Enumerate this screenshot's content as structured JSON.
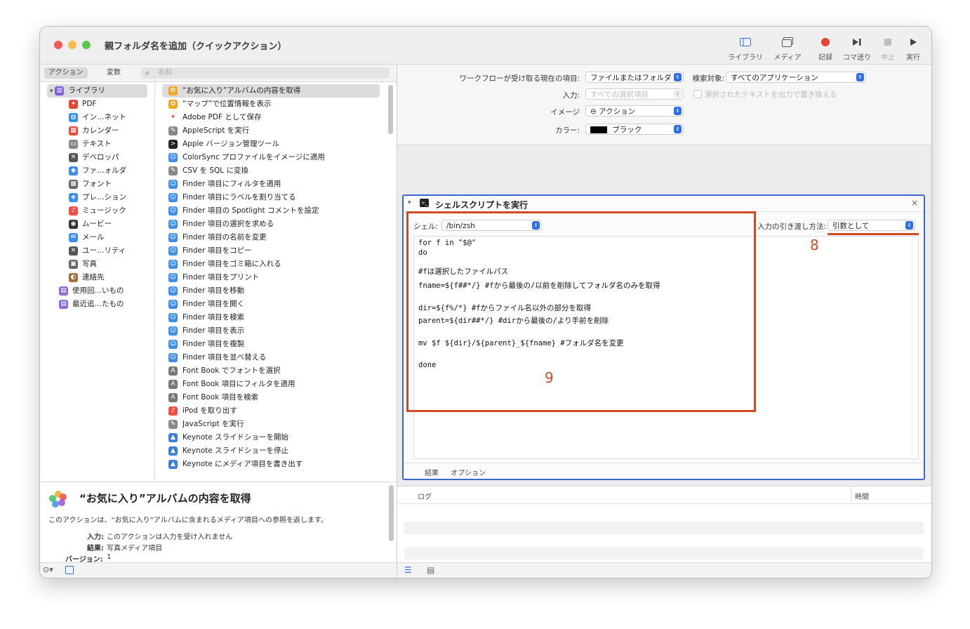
{
  "window": {
    "title": "親フォルダ名を追加（クイックアクション）"
  },
  "toolbar": {
    "library": "ライブラリ",
    "media": "メディア",
    "record": "記録",
    "step": "コマ送り",
    "stop": "中止",
    "run": "実行"
  },
  "left_header": {
    "actions_tab": "アクション",
    "variables_tab": "変数",
    "search_placeholder": "名前"
  },
  "categories": [
    "ライブラリ",
    "PDF",
    "イン…ネット",
    "カレンダー",
    "テキスト",
    "デベロッパ",
    "ファ…ォルダ",
    "フォント",
    "プレ…ション",
    "ミュージック",
    "ムービー",
    "メール",
    "ユー…リティ",
    "写真",
    "連絡先",
    "使用回…いもの",
    "最近追…たもの"
  ],
  "actions": [
    "“お気に入り”アルバムの内容を取得",
    "“マップ”で位置情報を表示",
    "Adobe PDF として保存",
    "AppleScript を実行",
    "Apple バージョン管理ツール",
    "ColorSync プロファイルをイメージに適用",
    "CSV を SQL に変換",
    "Finder 項目にフィルタを適用",
    "Finder 項目にラベルを割り当てる",
    "Finder 項目の Spotlight コメントを設定",
    "Finder 項目の選択を求める",
    "Finder 項目の名前を変更",
    "Finder 項目をコピー",
    "Finder 項目をゴミ箱に入れる",
    "Finder 項目をプリント",
    "Finder 項目を移動",
    "Finder 項目を開く",
    "Finder 項目を検索",
    "Finder 項目を表示",
    "Finder 項目を複製",
    "Finder 項目を並べ替える",
    "Font Book でフォントを選択",
    "Font Book 項目にフィルタを適用",
    "Font Book 項目を検索",
    "iPod を取り出す",
    "JavaScript を実行",
    "Keynote スライドショーを開始",
    "Keynote スライドショーを停止",
    "Keynote にメディア項目を書き出す"
  ],
  "description": {
    "title": "“お気に入り”アルバムの内容を取得",
    "text": "このアクションは、“お気に入り”アルバムに含まれるメディア項目への参照を返します。",
    "input_label": "入力:",
    "input_value": "このアクションは入力を受け入れません",
    "result_label": "結果:",
    "result_value": "写真メディア項目",
    "version_label": "バージョン:",
    "version_value": "1"
  },
  "workflow_config": {
    "receives_label": "ワークフローが受け取る現在の項目:",
    "receives_value": "ファイルまたはフォルダ",
    "search_label": "検索対象:",
    "search_value": "すべてのアプリケーション",
    "input_label": "入力:",
    "input_value": "すべての選択項目",
    "replace_label": "選択されたテキストを出力で置き換える",
    "image_label": "イメージ",
    "image_value": "⊖ アクション",
    "color_label": "カラー:",
    "color_value": "ブラック"
  },
  "shell_action": {
    "title": "シェルスクリプトを実行",
    "shell_label": "シェル:",
    "shell_value": "/bin/zsh",
    "pass_label": "入力の引き渡し方法:",
    "pass_value": "引数として",
    "code_lines": [
      "for f in \"$@\"",
      "do",
      "#fは選択したファイルパス",
      "fname=${f##*/} #fから最後の/以前を削除してフォルダ名のみを取得",
      "dir=${f%/*} #fからファイル名以外の部分を取得",
      "parent=${dir##*/} #dirから最後の/より手前を削除",
      "mv $f ${dir}/${parent}_${fname} #フォルダ名を変更",
      "done"
    ],
    "tab_results": "結果",
    "tab_options": "オプション"
  },
  "annotations": {
    "num8": "8",
    "num9": "9"
  },
  "log": {
    "col_log": "ログ",
    "col_time": "時間"
  },
  "colors": {
    "accent": "#2f6fe4",
    "annotation": "#d14a23",
    "panel_border": "#3b66d3"
  }
}
